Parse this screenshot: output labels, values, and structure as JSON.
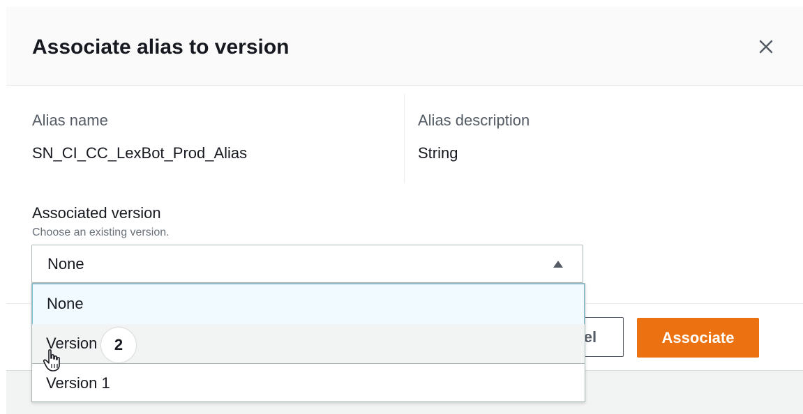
{
  "dialog": {
    "title": "Associate alias to version",
    "close_icon": "close-icon"
  },
  "alias": {
    "name_label": "Alias name",
    "name_value": "SN_CI_CC_LexBot_Prod_Alias",
    "description_label": "Alias description",
    "description_value": "String"
  },
  "version_field": {
    "label": "Associated version",
    "description": "Choose an existing version.",
    "selected_value": "None",
    "caret_icon": "caret-up-icon",
    "options": [
      {
        "label": "None",
        "state": "selected"
      },
      {
        "label": "Version 2",
        "state": "hovered"
      },
      {
        "label": "Version 1",
        "state": "normal"
      }
    ]
  },
  "buttons": {
    "cancel_label": "Cancel",
    "associate_label": "Associate"
  },
  "overlay": {
    "step_number": "2",
    "cursor_icon": "hand-cursor-icon"
  },
  "colors": {
    "primary_button": "#ec7211",
    "selected_option_border": "#7fbcd6",
    "text": "#16191f",
    "muted_text": "#545b64"
  }
}
